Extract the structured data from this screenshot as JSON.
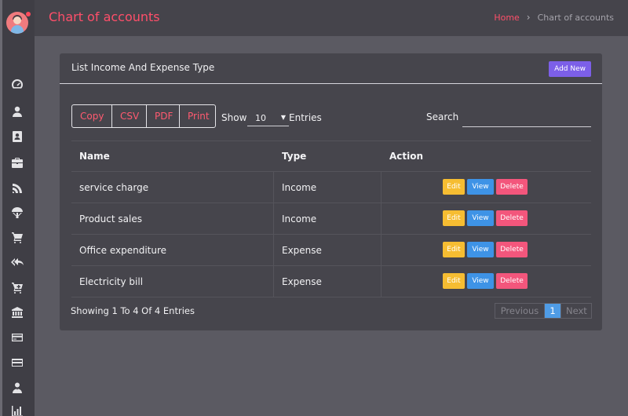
{
  "header": {
    "page_title": "Chart of accounts",
    "breadcrumb": {
      "home": "Home",
      "separator": "›",
      "current": "Chart of accounts"
    }
  },
  "sidebar": {
    "icons": [
      "dashboard-icon",
      "user-icon",
      "contacts-icon",
      "briefcase-icon",
      "satellite-icon",
      "parachute-icon",
      "cart-icon",
      "reply-all-icon",
      "cart-plus-icon",
      "bank-icon",
      "credit-card-icon",
      "card-icon",
      "user-tie-icon",
      "bar-chart-icon"
    ]
  },
  "card": {
    "title": "List Income And Expense Type",
    "add_new_label": "Add New",
    "export_buttons": {
      "copy": "Copy",
      "csv": "CSV",
      "pdf": "PDF",
      "print": "Print"
    },
    "show_label": "Show",
    "page_size": "10",
    "entries_label": "Entries",
    "search_label": "Search",
    "search_value": ""
  },
  "table": {
    "columns": [
      "Name",
      "Type",
      "Action"
    ],
    "rows": [
      {
        "name": "service charge",
        "type": "Income"
      },
      {
        "name": "Product sales",
        "type": "Income"
      },
      {
        "name": "Office expenditure",
        "type": "Expense"
      },
      {
        "name": "Electricity bill",
        "type": "Expense"
      }
    ],
    "action_labels": {
      "edit": "Edit",
      "view": "View",
      "delete": "Delete"
    }
  },
  "footer": {
    "info": "Showing 1 To 4 Of 4 Entries",
    "pagination": {
      "previous": "Previous",
      "page": "1",
      "next": "Next"
    }
  },
  "colors": {
    "accent": "#ff4f6a",
    "primary": "#7c5fe8",
    "edit": "#f6bd32",
    "view": "#3e93e6",
    "delete": "#f3567c"
  }
}
